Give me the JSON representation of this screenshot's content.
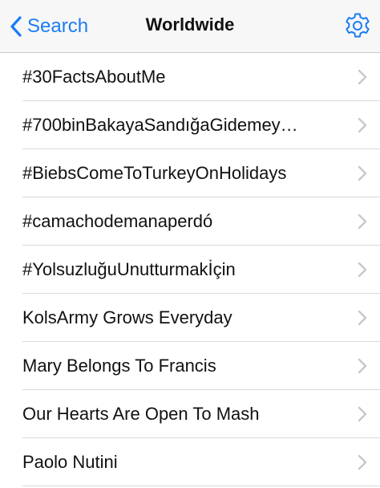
{
  "navbar": {
    "back_label": "Search",
    "title": "Worldwide",
    "settings_icon": "gear-icon"
  },
  "trends": [
    {
      "label": "#30FactsAboutMe"
    },
    {
      "label": "#700binBakayaSandığaGidemey…"
    },
    {
      "label": "#BiebsComeToTurkeyOnHolidays"
    },
    {
      "label": "#camachodemanaperdó"
    },
    {
      "label": "#YolsuzluğuUnutturmakİçin"
    },
    {
      "label": "KolsArmy Grows Everyday"
    },
    {
      "label": "Mary Belongs To Francis"
    },
    {
      "label": "Our Hearts Are Open To Mash"
    },
    {
      "label": "Paolo Nutini"
    }
  ],
  "colors": {
    "accent": "#1a7cf4",
    "chevron": "#c7c7cc",
    "separator": "#d9d8dd"
  }
}
